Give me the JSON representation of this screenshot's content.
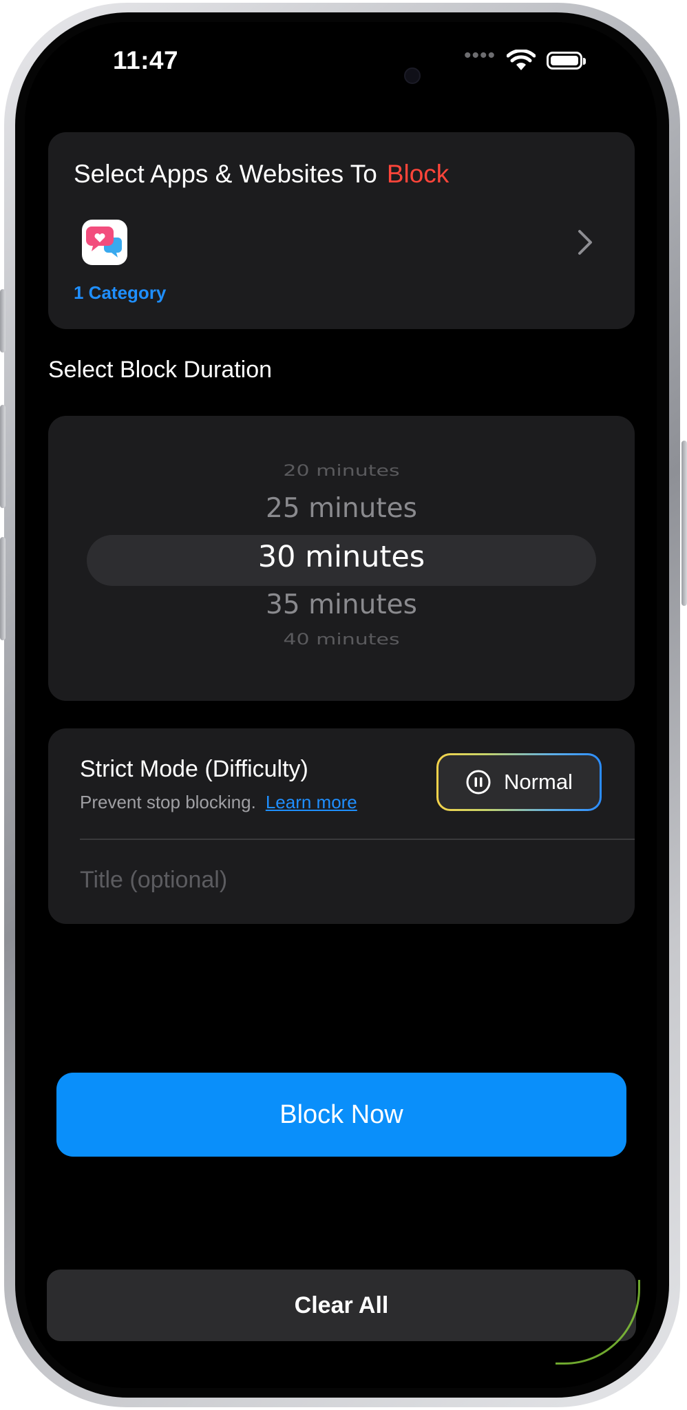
{
  "status_bar": {
    "time": "11:47",
    "signal": "••••",
    "wifi_icon": "wifi-icon",
    "battery_icon": "battery-full-icon"
  },
  "apps_section": {
    "title_prefix": "Select Apps & Websites To",
    "title_accent": "Block",
    "app_icon": "chat-heart-icon",
    "category_count": "1 Category",
    "accent_color": "#ff453a",
    "link_color": "#1f8fff"
  },
  "duration_section": {
    "label": "Select Block Duration",
    "options": [
      "20 minutes",
      "25 minutes",
      "30 minutes",
      "35 minutes",
      "40 minutes"
    ],
    "selected": "30 minutes"
  },
  "strict_mode": {
    "title": "Strict Mode (Difficulty)",
    "subtitle": "Prevent stop blocking.",
    "learn_more": "Learn more",
    "mode_label": "Normal",
    "mode_icon": "pause-circle-icon"
  },
  "title_field": {
    "placeholder": "Title (optional)",
    "value": ""
  },
  "actions": {
    "block_now": "Block Now",
    "block_now_color": "#0a8ffa",
    "clear_all": "Clear All"
  }
}
